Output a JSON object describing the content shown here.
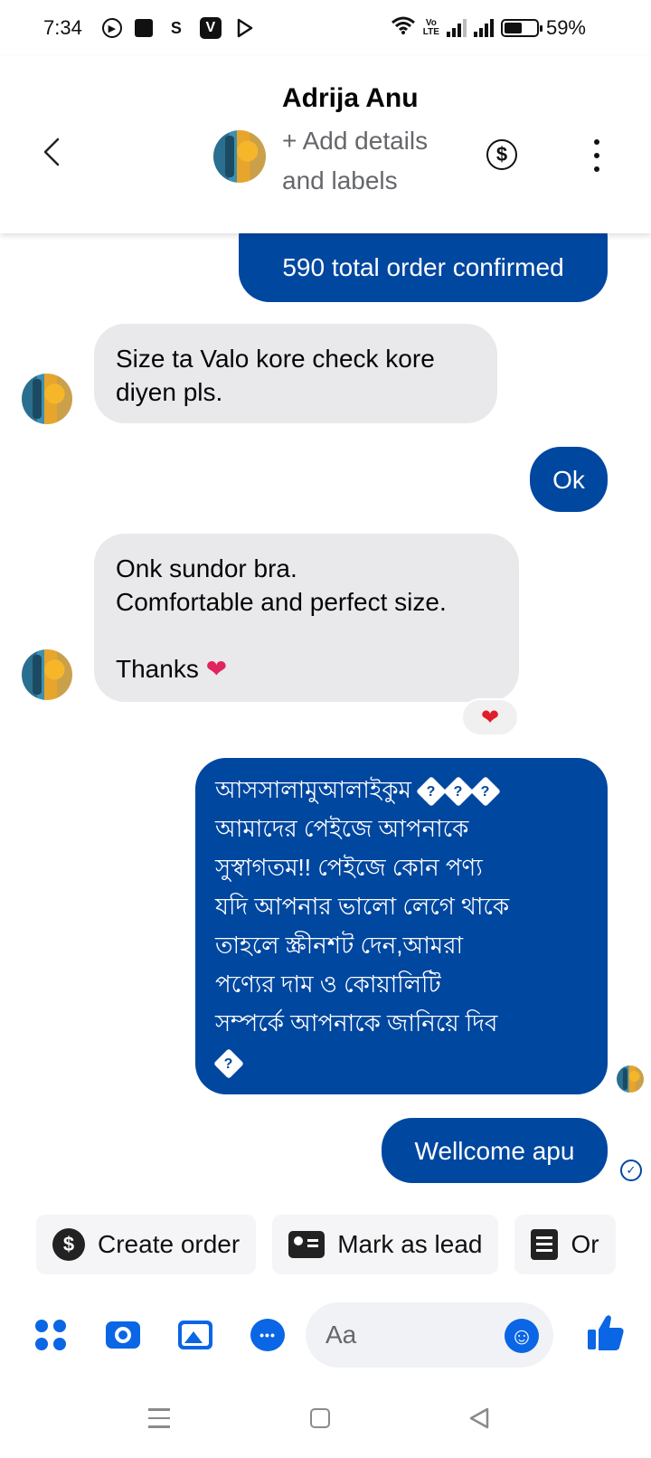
{
  "status_bar": {
    "time": "7:34",
    "app_icons": [
      "s-icon",
      "v-icon"
    ],
    "s_label": "S",
    "v_label": "V",
    "volte_line1": "Vo",
    "volte_line2": "LTE",
    "battery": "59%"
  },
  "header": {
    "contact_name": "Adrija Anu",
    "subtitle": "+ Add details and labels"
  },
  "messages": [
    {
      "direction": "out",
      "text": "590 total order confirmed"
    },
    {
      "direction": "in",
      "text": "Size ta Valo kore check kore diyen pls."
    },
    {
      "direction": "out",
      "text": "Ok"
    },
    {
      "direction": "in",
      "text_line1": "Onk sundor bra.",
      "text_line2": "Comfortable and perfect size.",
      "text_line3": "Thanks",
      "reaction": "❤"
    },
    {
      "direction": "out",
      "text_lines": [
        "আসসালামুআলাইকুম",
        "আমাদের পেইজে আপনাকে",
        "সুস্বাগতম!!  পেইজে কোন পণ্য",
        "যদি আপনার ভালো লেগে থাকে",
        "তাহলে স্ক্রীনশট দেন,আমরা",
        "পণ্যের দাম ও কোয়ালিটি",
        "সম্পর্কে আপনাকে জানিয়ে দিব"
      ],
      "replacement_glyph": "?"
    },
    {
      "direction": "out",
      "text": "Wellcome apu"
    }
  ],
  "quick_actions": {
    "create_order": "Create order",
    "mark_as_lead": "Mark as lead",
    "order_list": "Or"
  },
  "composer": {
    "placeholder": "Aa",
    "dollar_symbol": "$",
    "check_symbol": "✓"
  },
  "colors": {
    "outgoing_bubble": "#0047a0",
    "incoming_bubble": "#e9e9eb",
    "accent": "#0a66e4",
    "heart": "#e11d2a"
  }
}
